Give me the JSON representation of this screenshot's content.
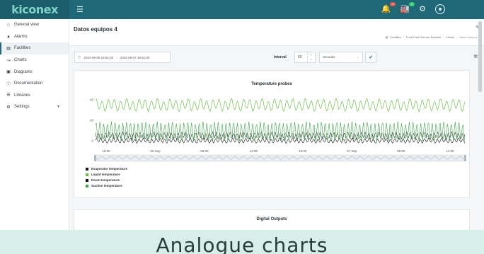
{
  "app": {
    "logo": "kiconex",
    "menu_icon": "hamburger-icon"
  },
  "topbar": {
    "icons": [
      {
        "name": "alarm-bell-icon",
        "badge": "42",
        "badge_color": "#e74c3c"
      },
      {
        "name": "facility-icon",
        "badge": "4",
        "badge_color": "#2ecc71"
      },
      {
        "name": "settings-gear-icon",
        "badge": ""
      },
      {
        "name": "user-avatar-icon",
        "badge": ""
      }
    ]
  },
  "sidebar": {
    "items": [
      {
        "label": "General view",
        "icon": "home-icon"
      },
      {
        "label": "Alarms",
        "icon": "bell-icon"
      },
      {
        "label": "Facilities",
        "icon": "factory-icon",
        "active": true
      },
      {
        "label": "Charts",
        "icon": "line-chart-icon"
      },
      {
        "label": "Diagrams",
        "icon": "image-icon"
      },
      {
        "label": "Documentation",
        "icon": "question-icon"
      },
      {
        "label": "Libraries",
        "icon": "list-icon"
      },
      {
        "label": "Settings",
        "icon": "gears-icon",
        "has_submenu": true
      }
    ]
  },
  "header": {
    "title": "Datos equipos 4",
    "breadcrumb": [
      "Facilities",
      "Food Point Service Baskets",
      "Charts",
      "Datos equipos 4"
    ]
  },
  "controls": {
    "date_from": "2022-09-05 16:51:00",
    "date_separator": "-",
    "date_to": "2022-09-07 16:51:00",
    "interval_label": "Interval",
    "interval_value": "60",
    "interval_unit": "Seconds"
  },
  "cards": {
    "temperature_title": "Temperature probes",
    "digital_title": "Digital Outputs"
  },
  "caption": "Analogue charts",
  "colors": {
    "topbar": "#1f6878",
    "accent": "#1f6878",
    "green": "#5cb85c",
    "dark": "#1f1f1f"
  },
  "chart_data": {
    "type": "line",
    "title": "Temperature probes",
    "xlabel": "",
    "ylabel": "",
    "ylim": [
      -5,
      45
    ],
    "yticks": [
      0,
      20,
      40
    ],
    "xticks": [
      "18:00",
      "06 Sep",
      "06:00",
      "12:00",
      "18:00",
      "07 Sep",
      "06:00",
      "12:00"
    ],
    "legend_position": "bottom-left",
    "grid": true,
    "series": [
      {
        "name": "Evaporator temperature",
        "color": "#1a1a1a",
        "band": [
          -2,
          2
        ]
      },
      {
        "name": "Liquid temperature",
        "color": "#6cc04a",
        "band": [
          30,
          40
        ]
      },
      {
        "name": "Room temperature",
        "color": "#111111",
        "band": [
          2,
          8
        ]
      },
      {
        "name": "Suction temperature",
        "color": "#3fa34d",
        "band": [
          0,
          18
        ]
      }
    ]
  }
}
